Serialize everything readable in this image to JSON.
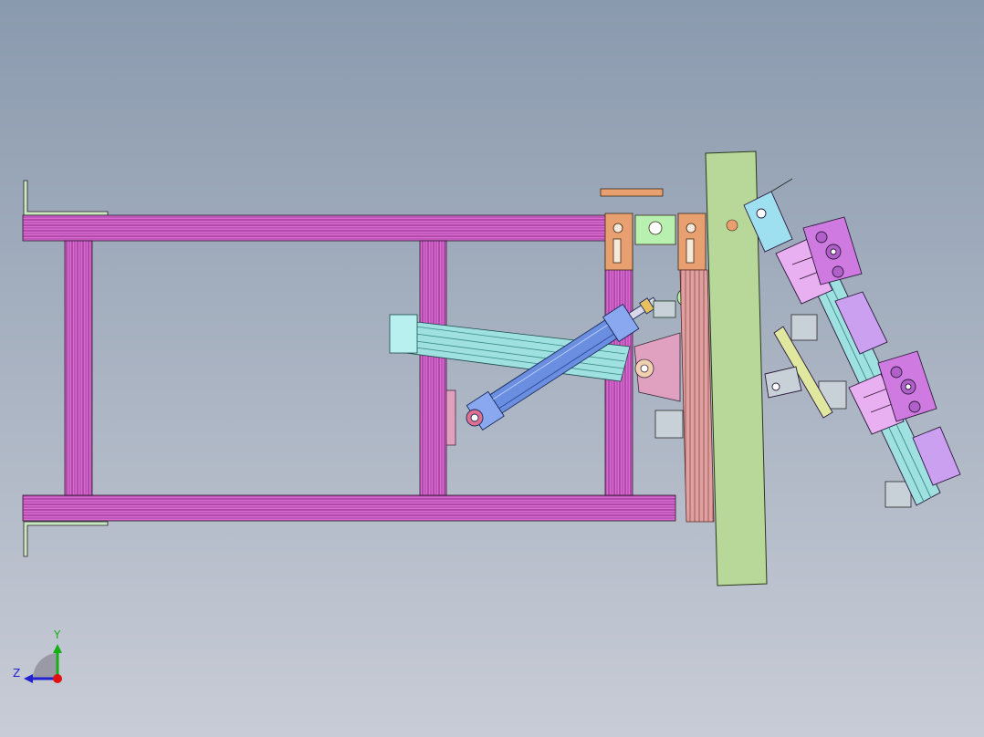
{
  "viewport": {
    "background_top": "#8a9aae",
    "background_bottom": "#c8ccd6"
  },
  "colors": {
    "frame_profile": "#d86ad0",
    "frame_profile_dark": "#8a2a86",
    "cylinder_body": "#6a8fe0",
    "cylinder_dark": "#2e4aa0",
    "guide_rail": "#9fe0e0",
    "green_plate": "#b8d89a",
    "orange_bracket": "#e8a070",
    "salmon_plate": "#e0a0a0",
    "purple_block": "#cf7ae0",
    "lavender_pad": "#cca0f0",
    "light_green_block": "#b8f0b0",
    "yellow_green_bar": "#e0e8a0",
    "gray_block": "#c8d0d8",
    "triad_y": "#16b016",
    "triad_z": "#2020d0",
    "triad_x": "#e01010"
  },
  "triad": {
    "y_label": "Y",
    "z_label": "Z"
  }
}
